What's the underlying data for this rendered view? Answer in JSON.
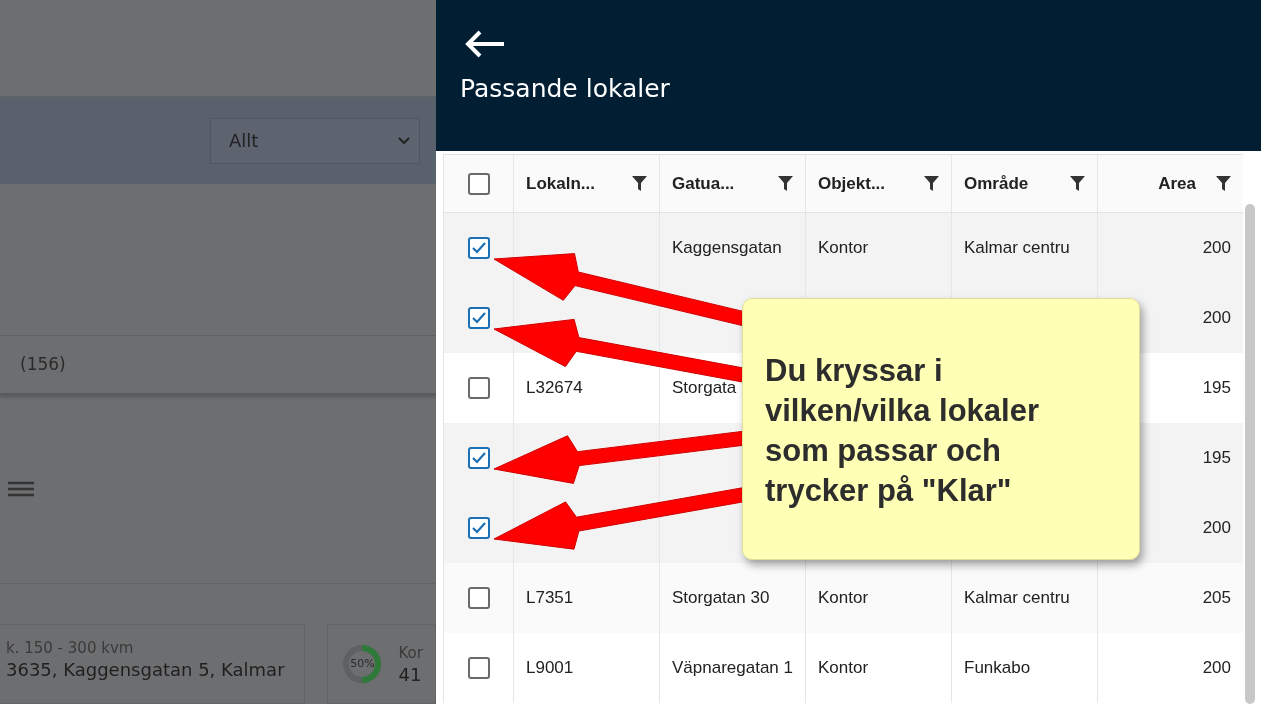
{
  "background": {
    "filter_select": "Allt",
    "count_label": "(156)",
    "card": {
      "subtitle": "k. 150 - 300 kvm",
      "address": "3635, Kaggensgatan 5, Kalmar"
    },
    "progress_card": {
      "percent": "50%",
      "level": 0.5,
      "label": "Kor",
      "value": "41"
    }
  },
  "drawer": {
    "title": "Passande lokaler",
    "select_all_checked": false,
    "table": {
      "columns": [
        "Lokaln...",
        "Gatua...",
        "Objekt...",
        "Område",
        "Area"
      ],
      "rows": [
        {
          "checked": true,
          "cells": [
            "",
            "Kaggensgatan",
            "Kontor",
            "Kalmar centru",
            "200"
          ]
        },
        {
          "checked": true,
          "cells": [
            "",
            "",
            "",
            "",
            "200"
          ]
        },
        {
          "checked": false,
          "cells": [
            "L32674",
            "Storgata",
            "",
            "",
            "195"
          ]
        },
        {
          "checked": true,
          "cells": [
            "",
            "",
            "",
            "",
            "195"
          ]
        },
        {
          "checked": true,
          "cells": [
            "",
            "",
            "",
            "",
            "200"
          ]
        },
        {
          "checked": false,
          "cells": [
            "L7351",
            "Storgatan 30",
            "Kontor",
            "Kalmar centru",
            "205"
          ]
        },
        {
          "checked": false,
          "cells": [
            "L9001",
            "Väpnaregatan 1",
            "Kontor",
            "Funkabo",
            "200"
          ]
        }
      ]
    }
  },
  "callout": {
    "text": "Du kryssar i vilken/vilka lokaler som passar och trycker på \"Klar\""
  }
}
